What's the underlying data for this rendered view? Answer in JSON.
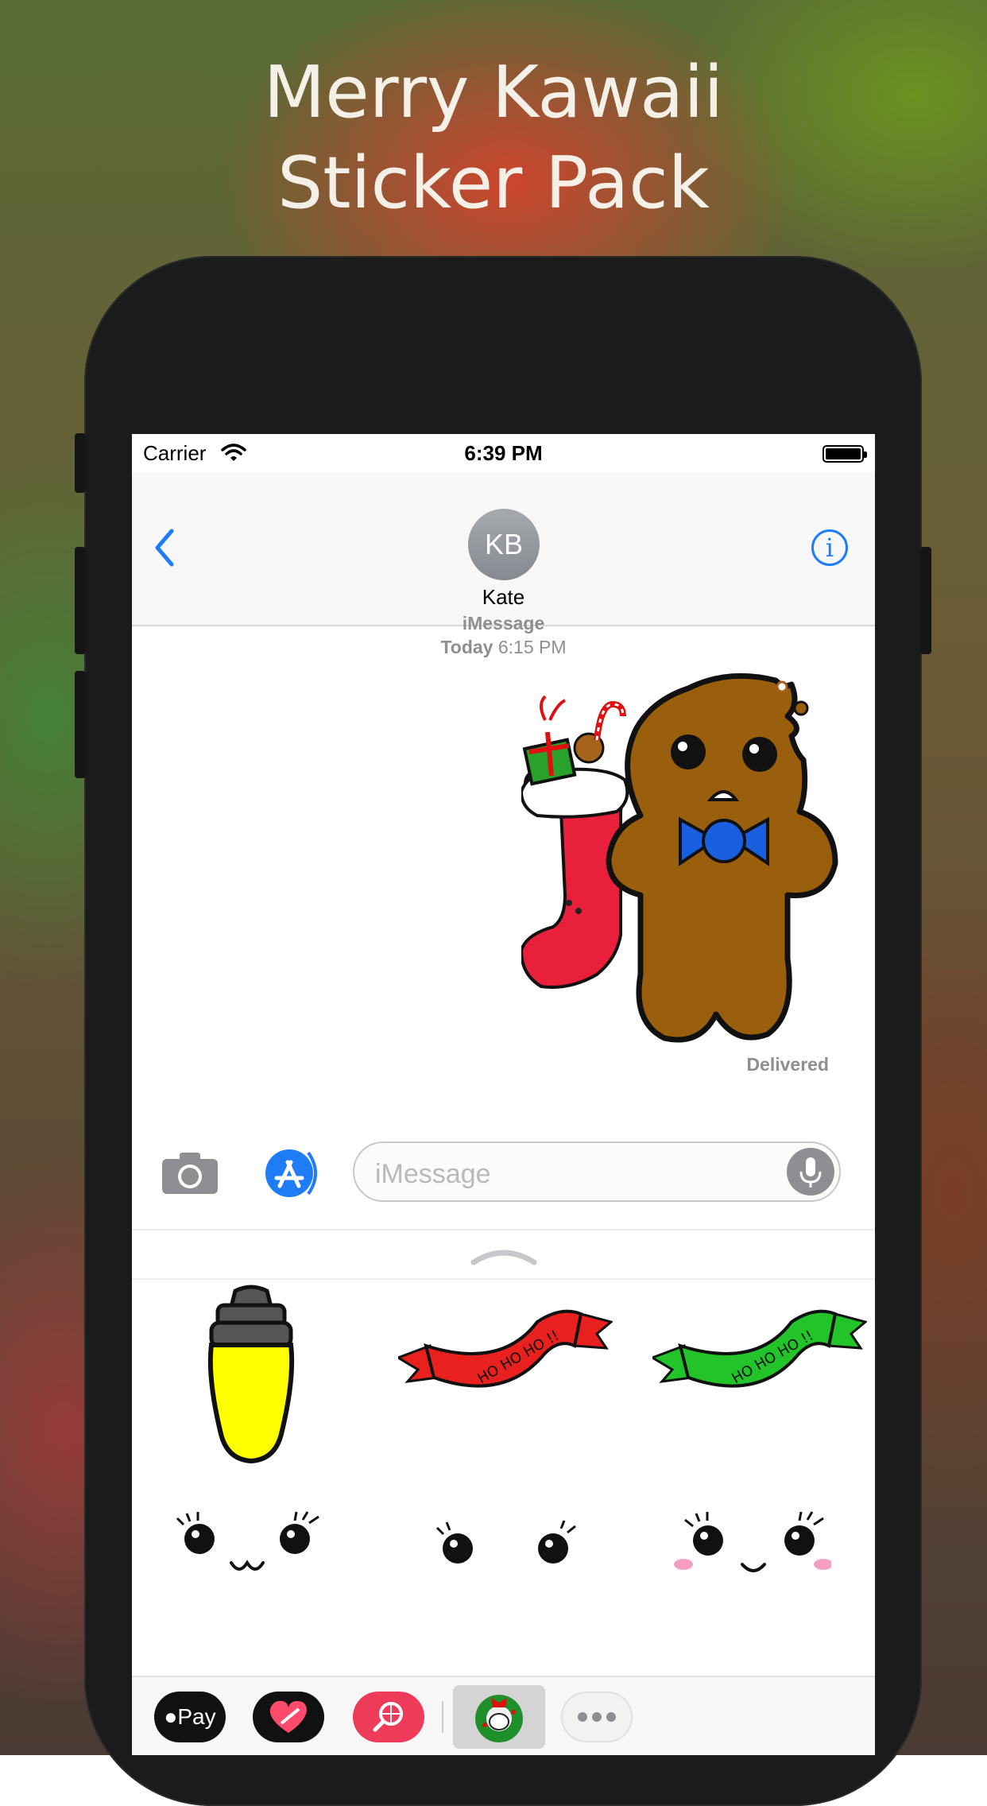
{
  "headline": {
    "line1": "Merry Kawaii",
    "line2": "Sticker Pack"
  },
  "status_bar": {
    "carrier": "Carrier",
    "time": "6:39 PM"
  },
  "nav": {
    "avatar_initials": "KB",
    "contact_name": "Kate"
  },
  "thread": {
    "service": "iMessage",
    "day": "Today",
    "time": "6:15 PM",
    "delivery": "Delivered"
  },
  "compose": {
    "placeholder": "iMessage"
  },
  "app_strip": {
    "apple_pay_label": "Pay"
  },
  "stickers": [
    "gingerbread-sticker",
    "christmas-light-sticker",
    "red-ho-ho-ho-banner-sticker",
    "green-ho-ho-ho-banner-sticker",
    "kawaii-eyes-smile-sticker",
    "kawaii-eyes-sticker",
    "kawaii-blush-face-sticker"
  ],
  "colors": {
    "ios_blue": "#1f7cf7",
    "gingerbread": "#9a5f0c",
    "stocking": "#e8203c",
    "bowtie": "#1a5fe0"
  }
}
